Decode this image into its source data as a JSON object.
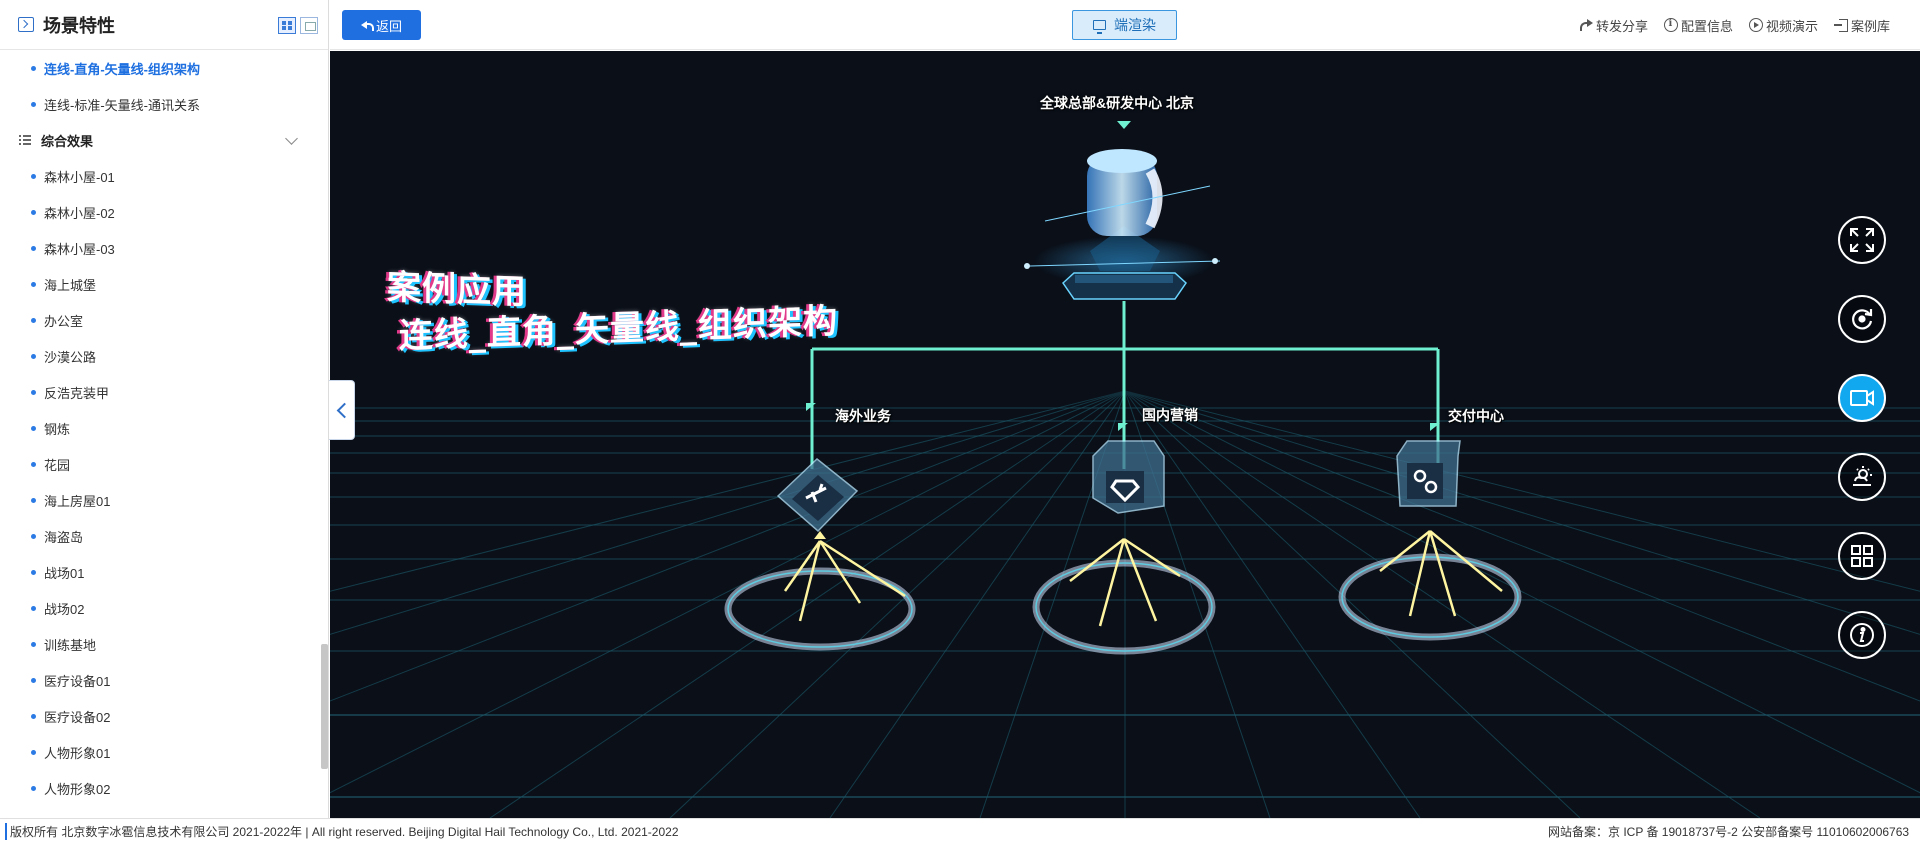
{
  "sidebar": {
    "title": "场景特性",
    "items_top": [
      {
        "label": "连线-直角-矢量线-组织架构",
        "active": true
      },
      {
        "label": "连线-标准-矢量线-通讯关系",
        "active": false
      }
    ],
    "group": {
      "label": "综合效果"
    },
    "items": [
      "森林小屋-01",
      "森林小屋-02",
      "森林小屋-03",
      "海上城堡",
      "办公室",
      "沙漠公路",
      "反浩克装甲",
      "钢炼",
      "花园",
      "海上房屋01",
      "海盗岛",
      "战场01",
      "战场02",
      "训练基地",
      "医疗设备01",
      "医疗设备02",
      "人物形象01",
      "人物形象02"
    ]
  },
  "topbar": {
    "back_label": "返回",
    "render_label": "端渲染",
    "links": [
      {
        "label": "转发分享",
        "icon": "share-icon"
      },
      {
        "label": "配置信息",
        "icon": "info-icon"
      },
      {
        "label": "视频演示",
        "icon": "play-icon"
      },
      {
        "label": "案例库",
        "icon": "library-icon"
      }
    ]
  },
  "scene": {
    "title_line1": "案例应用",
    "title_line2": "连线_直角_矢量线_组织架构",
    "root_label": "全球总部&研发中心 北京",
    "nodes": [
      "海外业务",
      "国内营销",
      "交付中心"
    ],
    "accent": "#6ff0d0"
  },
  "tools": [
    "fullscreen-icon",
    "rotate-icon",
    "camera-icon",
    "weather-icon",
    "grid-icon",
    "info-icon"
  ],
  "footer": {
    "left": "版权所有 北京数字冰雹信息技术有限公司 2021-2022年 | All right reserved. Beijing Digital Hail Technology Co., Ltd. 2021-2022",
    "right": "网站备案：京 ICP 备 19018737号-2 公安部备案号 11010602006763"
  }
}
